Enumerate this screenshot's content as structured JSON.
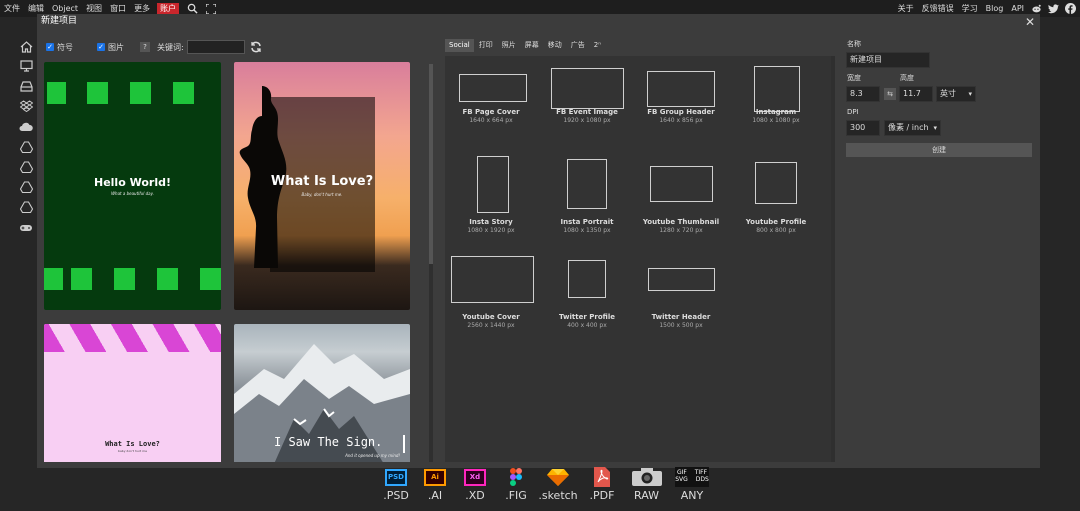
{
  "menubar": {
    "items": [
      "文件",
      "编辑",
      "Object",
      "视图",
      "窗口",
      "更多"
    ],
    "account": "账户",
    "right_items": [
      "关于",
      "反馈错误",
      "学习",
      "Blog",
      "API"
    ]
  },
  "dialog": {
    "title": "新建项目",
    "filters": {
      "symbol_label": "符号",
      "image_label": "图片",
      "help": "?",
      "keyword_label": "关键词:",
      "keyword_value": ""
    },
    "templates": [
      {
        "title": "Hello World!",
        "subtitle": "What a beautiful day."
      },
      {
        "title": "What Is Love?",
        "subtitle": "Baby, don't hurt me."
      },
      {
        "title": "What Is Love?",
        "subtitle": "baby don't hurt me"
      },
      {
        "title": "I Saw The Sign.",
        "subtitle": "And it opened up my mind!"
      }
    ],
    "preset_tabs": [
      "Social",
      "打印",
      "照片",
      "屏幕",
      "移动",
      "广告",
      "2ⁿ"
    ],
    "active_tab": "Social",
    "presets": [
      {
        "name": "FB Page Cover",
        "size": "1640 x 664 px"
      },
      {
        "name": "FB Event Image",
        "size": "1920 x 1080 px"
      },
      {
        "name": "FB Group Header",
        "size": "1640 x 856 px"
      },
      {
        "name": "Instagram",
        "size": "1080 x 1080 px"
      },
      {
        "name": "Insta Story",
        "size": "1080 x 1920 px"
      },
      {
        "name": "Insta Portrait",
        "size": "1080 x 1350 px"
      },
      {
        "name": "Youtube Thumbnail",
        "size": "1280 x 720 px"
      },
      {
        "name": "Youtube Profile",
        "size": "800 x 800 px"
      },
      {
        "name": "Youtube Cover",
        "size": "2560 x 1440 px"
      },
      {
        "name": "Twitter Profile",
        "size": "400 x 400 px"
      },
      {
        "name": "Twitter Header",
        "size": "1500 x 500 px"
      }
    ],
    "form": {
      "name_label": "名称",
      "name_value": "新建项目",
      "width_label": "宽度",
      "width_value": "8.3",
      "height_label": "高度",
      "height_value": "11.7",
      "unit_value": "英寸",
      "dpi_label": "DPI",
      "dpi_value": "300",
      "dpi_unit": "像素 / inch",
      "create_label": "创建",
      "link_icon": "⇆"
    }
  },
  "formats": [
    {
      "label": ".PSD",
      "badge": "PSD",
      "color": "#31a8ff"
    },
    {
      "label": ".AI",
      "badge": "Ai",
      "color": "#ff9a00"
    },
    {
      "label": ".XD",
      "badge": "Xd",
      "color": "#ff26be"
    },
    {
      "label": ".FIG",
      "badge": "",
      "color": "#a259ff"
    },
    {
      "label": ".sketch",
      "badge": "",
      "color": "#f7b500"
    },
    {
      "label": ".PDF",
      "badge": "",
      "color": "#e2574c"
    },
    {
      "label": "RAW",
      "badge": "",
      "color": "#cccccc"
    },
    {
      "label": "ANY",
      "badge": "GIF TIFF SVG DDS",
      "color": "#ffffff"
    }
  ]
}
